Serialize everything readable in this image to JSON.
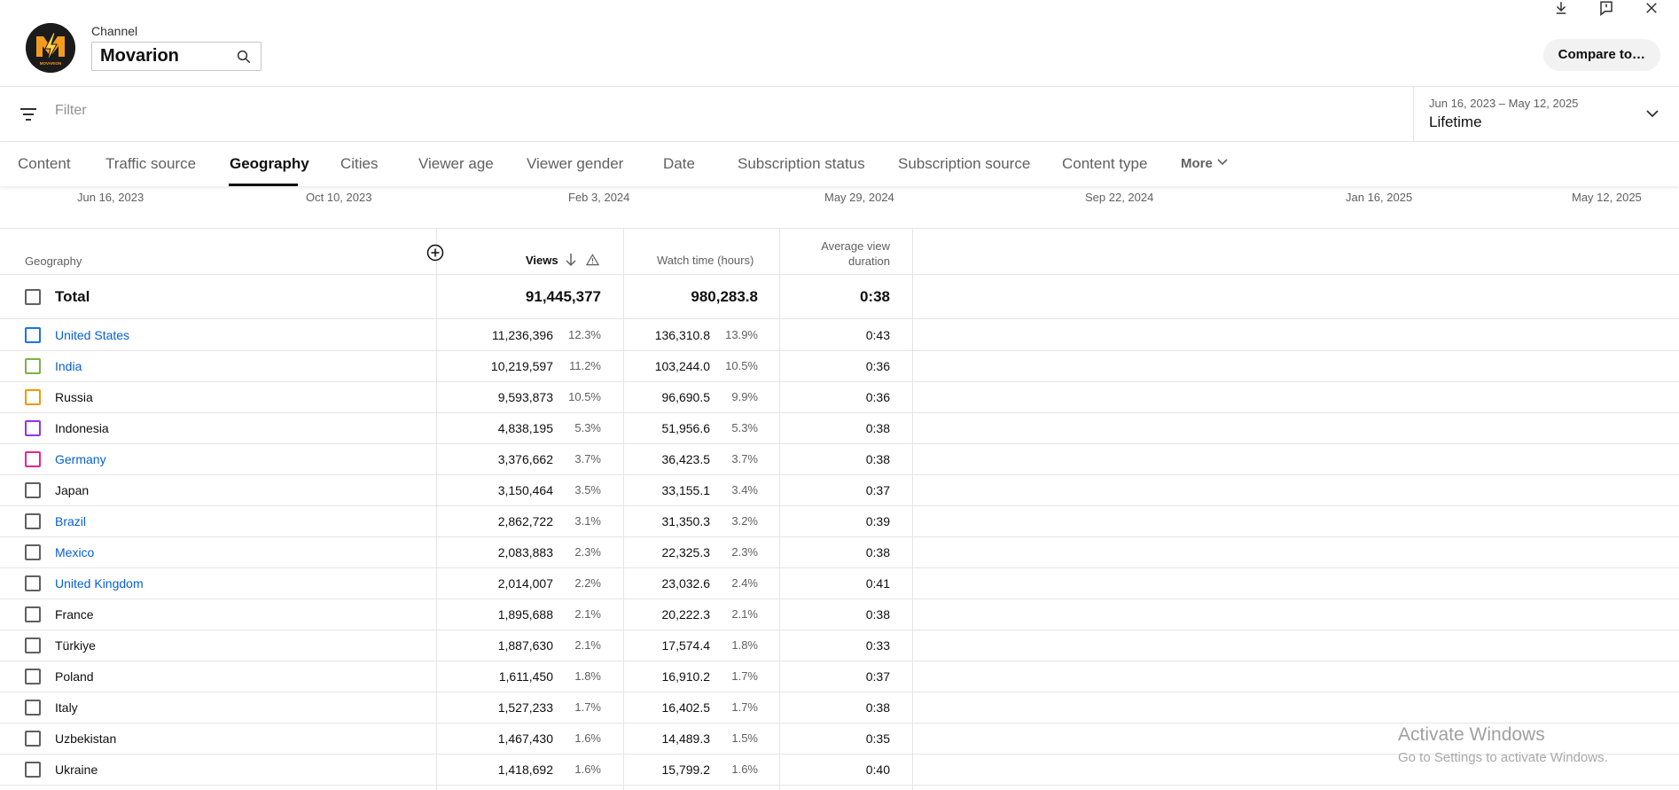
{
  "header": {
    "channel_label": "Channel",
    "channel_name": "Movarion",
    "compare_button": "Compare to…",
    "logo_text": "MOVARION"
  },
  "filter": {
    "placeholder": "Filter"
  },
  "date_range": {
    "range": "Jun 16, 2023 – May 12, 2025",
    "label": "Lifetime"
  },
  "tabs": [
    {
      "label": "Content",
      "active": false
    },
    {
      "label": "Traffic source",
      "active": false
    },
    {
      "label": "Geography",
      "active": true
    },
    {
      "label": "Cities",
      "active": false
    },
    {
      "label": "Viewer age",
      "active": false
    },
    {
      "label": "Viewer gender",
      "active": false
    },
    {
      "label": "Date",
      "active": false
    },
    {
      "label": "Subscription status",
      "active": false
    },
    {
      "label": "Subscription source",
      "active": false
    },
    {
      "label": "Content type",
      "active": false
    },
    {
      "label": "More",
      "active": false
    }
  ],
  "timeline_ticks": [
    "Jun 16, 2023",
    "Oct 10, 2023",
    "Feb 3, 2024",
    "May 29, 2024",
    "Sep 22, 2024",
    "Jan 16, 2025",
    "May 12, 2025"
  ],
  "table": {
    "headers": {
      "geography": "Geography",
      "views": "Views",
      "watch_time": "Watch time (hours)",
      "avg_view_duration_1": "Average view",
      "avg_view_duration_2": "duration"
    },
    "total": {
      "label": "Total",
      "views": "91,445,377",
      "watch_time": "980,283.8",
      "avg_duration": "0:38"
    },
    "rows": [
      {
        "country": "United States",
        "link": true,
        "color": "#1a73e8",
        "views": "11,236,396",
        "views_pct": "12.3%",
        "watch": "136,310.8",
        "watch_pct": "13.9%",
        "avd": "0:43"
      },
      {
        "country": "India",
        "link": true,
        "color": "#7cb342",
        "views": "10,219,597",
        "views_pct": "11.2%",
        "watch": "103,244.0",
        "watch_pct": "10.5%",
        "avd": "0:36"
      },
      {
        "country": "Russia",
        "link": false,
        "color": "#f29900",
        "views": "9,593,873",
        "views_pct": "10.5%",
        "watch": "96,690.5",
        "watch_pct": "9.9%",
        "avd": "0:36"
      },
      {
        "country": "Indonesia",
        "link": false,
        "color": "#9334e6",
        "views": "4,838,195",
        "views_pct": "5.3%",
        "watch": "51,956.6",
        "watch_pct": "5.3%",
        "avd": "0:38"
      },
      {
        "country": "Germany",
        "link": true,
        "color": "#e52592",
        "views": "3,376,662",
        "views_pct": "3.7%",
        "watch": "36,423.5",
        "watch_pct": "3.7%",
        "avd": "0:38"
      },
      {
        "country": "Japan",
        "link": false,
        "color": "#606060",
        "views": "3,150,464",
        "views_pct": "3.5%",
        "watch": "33,155.1",
        "watch_pct": "3.4%",
        "avd": "0:37"
      },
      {
        "country": "Brazil",
        "link": true,
        "color": "#606060",
        "views": "2,862,722",
        "views_pct": "3.1%",
        "watch": "31,350.3",
        "watch_pct": "3.2%",
        "avd": "0:39"
      },
      {
        "country": "Mexico",
        "link": true,
        "color": "#606060",
        "views": "2,083,883",
        "views_pct": "2.3%",
        "watch": "22,325.3",
        "watch_pct": "2.3%",
        "avd": "0:38"
      },
      {
        "country": "United Kingdom",
        "link": true,
        "color": "#606060",
        "views": "2,014,007",
        "views_pct": "2.2%",
        "watch": "23,032.6",
        "watch_pct": "2.4%",
        "avd": "0:41"
      },
      {
        "country": "France",
        "link": false,
        "color": "#606060",
        "views": "1,895,688",
        "views_pct": "2.1%",
        "watch": "20,222.3",
        "watch_pct": "2.1%",
        "avd": "0:38"
      },
      {
        "country": "Türkiye",
        "link": false,
        "color": "#606060",
        "views": "1,887,630",
        "views_pct": "2.1%",
        "watch": "17,574.4",
        "watch_pct": "1.8%",
        "avd": "0:33"
      },
      {
        "country": "Poland",
        "link": false,
        "color": "#606060",
        "views": "1,611,450",
        "views_pct": "1.8%",
        "watch": "16,910.2",
        "watch_pct": "1.7%",
        "avd": "0:37"
      },
      {
        "country": "Italy",
        "link": false,
        "color": "#606060",
        "views": "1,527,233",
        "views_pct": "1.7%",
        "watch": "16,402.5",
        "watch_pct": "1.7%",
        "avd": "0:38"
      },
      {
        "country": "Uzbekistan",
        "link": false,
        "color": "#606060",
        "views": "1,467,430",
        "views_pct": "1.6%",
        "watch": "14,489.3",
        "watch_pct": "1.5%",
        "avd": "0:35"
      },
      {
        "country": "Ukraine",
        "link": false,
        "color": "#606060",
        "views": "1,418,692",
        "views_pct": "1.6%",
        "watch": "15,799.2",
        "watch_pct": "1.6%",
        "avd": "0:40"
      }
    ]
  },
  "watermark": {
    "title": "Activate Windows",
    "subtitle": "Go to Settings to activate Windows."
  },
  "icons": {
    "search": "search-icon",
    "filter": "filter-icon",
    "download": "download-icon",
    "feedback": "feedback-icon",
    "close": "close-icon",
    "chevron": "chevron-down-icon",
    "add": "add-circle-icon",
    "sort": "arrow-down-icon",
    "warning": "warning-icon"
  }
}
